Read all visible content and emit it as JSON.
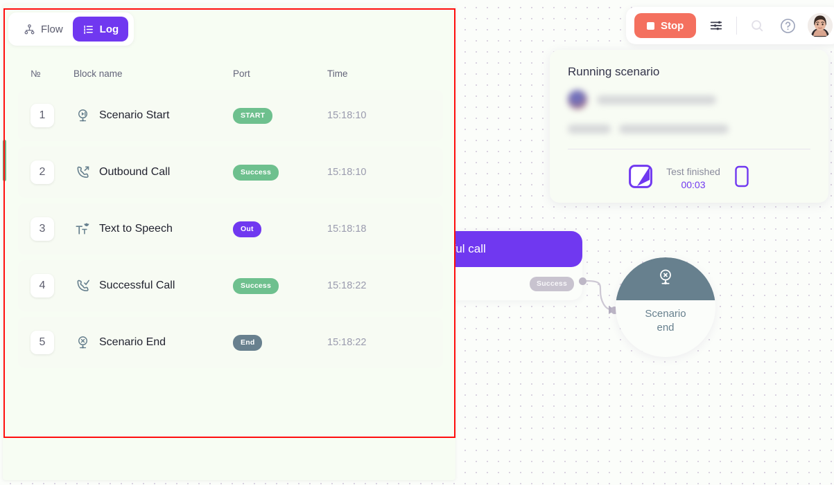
{
  "tabs": {
    "flow": {
      "label": "Flow",
      "icon": "hierarchy-icon",
      "active": false
    },
    "log": {
      "label": "Log",
      "icon": "list-icon",
      "active": true
    }
  },
  "log_table": {
    "columns": {
      "no": "№",
      "block_name": "Block name",
      "port": "Port",
      "time": "Time"
    },
    "rows": [
      {
        "no": "1",
        "icon": "scenario-start-icon",
        "block_name": "Scenario Start",
        "port": "START",
        "port_color": "#6ec08e",
        "time": "15:18:10"
      },
      {
        "no": "2",
        "icon": "outbound-call-icon",
        "block_name": "Outbound Call",
        "port": "Success",
        "port_color": "#6ec08e",
        "time": "15:18:10"
      },
      {
        "no": "3",
        "icon": "text-to-speech-icon",
        "block_name": "Text to Speech",
        "port": "Out",
        "port_color": "#7038f0",
        "time": "15:18:18"
      },
      {
        "no": "4",
        "icon": "successful-call-icon",
        "block_name": "Successful Call",
        "port": "Success",
        "port_color": "#6ec08e",
        "time": "15:18:22"
      },
      {
        "no": "5",
        "icon": "scenario-end-icon",
        "block_name": "Scenario End",
        "port": "End",
        "port_color": "#68808e",
        "time": "15:18:22"
      }
    ]
  },
  "running_scenario": {
    "title": "Running scenario",
    "status_label": "Test finished",
    "status_time": "00:03",
    "scenario_icon": "scenario-badge-icon",
    "device_icon": "phone-icon"
  },
  "toolbar": {
    "stop_label": "Stop",
    "settings_icon": "sliders-icon",
    "search_icon": "search-icon",
    "help_icon": "question-circle-icon",
    "avatar": "user-avatar"
  },
  "canvas": {
    "call_node": {
      "title": "...essful call",
      "port": "Success"
    },
    "end_node": {
      "label_line1": "Scenario",
      "label_line2": "end",
      "icon": "scenario-end-icon"
    }
  },
  "colors": {
    "accent_purple": "#7038f0",
    "success_green": "#6ec08e",
    "stop_red": "#f4705f",
    "slate": "#68808e",
    "annotation_red": "#ff0d0d"
  }
}
